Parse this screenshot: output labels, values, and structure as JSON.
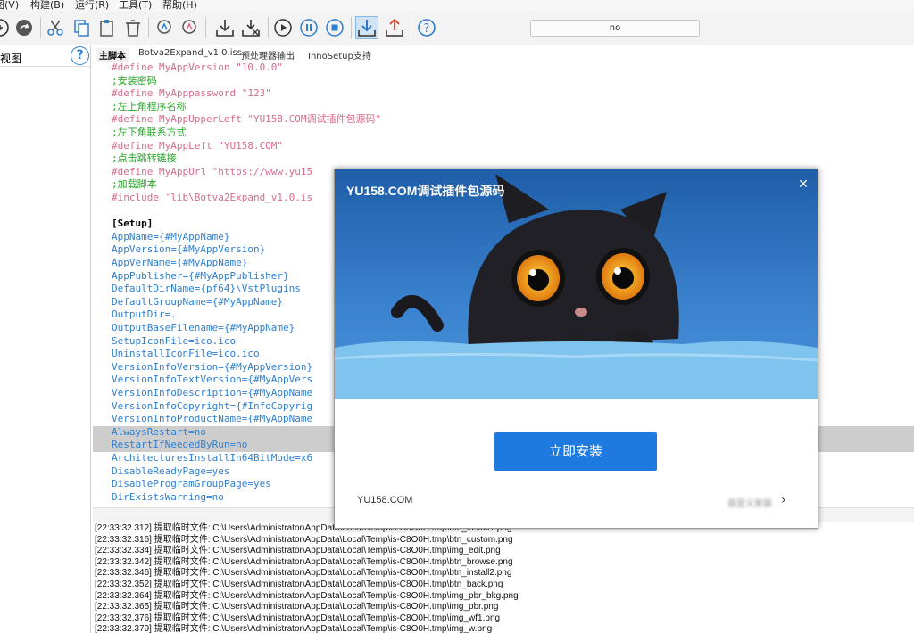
{
  "menu": {
    "view": "图(V)",
    "build": "构建(B)",
    "run": "运行(R)",
    "tools": "工具(T)",
    "help": "帮助(H)"
  },
  "toolbar": {
    "config_value": "no"
  },
  "left_panel": {
    "title": "视图",
    "help_glyph": "?"
  },
  "tabs": [
    "主脚本",
    "Botva2Expand_v1.0.iss",
    "预处理器输出",
    "InnoSetup支持"
  ],
  "editor_lines": [
    {
      "cls": "c-dir",
      "text": "#define MyAppVersion \"10.0.0\""
    },
    {
      "cls": "c-cmt",
      "text": ";安装密码"
    },
    {
      "cls": "c-dir",
      "text": "#define MyApppassword \"123\""
    },
    {
      "cls": "c-cmt",
      "text": ";左上角程序名称"
    },
    {
      "cls": "c-dir",
      "text": "#define MyAppUpperLeft \"YU158.COM调试插件包源码\""
    },
    {
      "cls": "c-cmt",
      "text": ";左下角联系方式"
    },
    {
      "cls": "c-dir",
      "text": "#define MyAppLeft \"YU158.COM\""
    },
    {
      "cls": "c-cmt",
      "text": ";点击跳转链接"
    },
    {
      "cls": "c-dir",
      "text": "#define MyAppUrl \"https://www.yu15"
    },
    {
      "cls": "c-cmt",
      "text": ";加载脚本"
    },
    {
      "cls": "c-dir",
      "text": "#include 'lib\\Botva2Expand_v1.0.is"
    },
    {
      "cls": "",
      "text": ""
    },
    {
      "cls": "c-sec",
      "text": "[Setup]"
    },
    {
      "cls": "c-key",
      "text": "AppName={#MyAppName}"
    },
    {
      "cls": "c-key",
      "text": "AppVersion={#MyAppVersion}"
    },
    {
      "cls": "c-key",
      "text": "AppVerName={#MyAppName}"
    },
    {
      "cls": "c-key",
      "text": "AppPublisher={#MyAppPublisher}"
    },
    {
      "cls": "c-key",
      "text": "DefaultDirName={pf64}\\VstPlugins"
    },
    {
      "cls": "c-key",
      "text": "DefaultGroupName={#MyAppName}"
    },
    {
      "cls": "c-key",
      "text": "OutputDir=."
    },
    {
      "cls": "c-key",
      "text": "OutputBaseFilename={#MyAppName}"
    },
    {
      "cls": "c-key",
      "text": "SetupIconFile=ico.ico"
    },
    {
      "cls": "c-key",
      "text": "UninstallIconFile=ico.ico"
    },
    {
      "cls": "c-key",
      "text": "VersionInfoVersion={#MyAppVersion}"
    },
    {
      "cls": "c-key",
      "text": "VersionInfoTextVersion={#MyAppVers"
    },
    {
      "cls": "c-key",
      "text": "VersionInfoDescription={#MyAppName"
    },
    {
      "cls": "c-key",
      "text": "VersionInfoCopyright={#InfoCopyrig"
    },
    {
      "cls": "c-key",
      "text": "VersionInfoProductName={#MyAppName"
    },
    {
      "cls": "c-key",
      "text": "AlwaysRestart=no",
      "hl": true
    },
    {
      "cls": "c-key",
      "text": "RestartIfNeededByRun=no",
      "hl": true
    },
    {
      "cls": "c-key",
      "text": "ArchitecturesInstallIn64BitMode=x6"
    },
    {
      "cls": "c-key",
      "text": "DisableReadyPage=yes"
    },
    {
      "cls": "c-key",
      "text": "DisableProgramGroupPage=yes"
    },
    {
      "cls": "c-key",
      "text": "DirExistsWarning=no"
    }
  ],
  "log_lines": [
    "[22:33:32.312]   提取临时文件: C:\\Users\\Administrator\\AppData\\Local\\Temp\\is-C8O0H.tmp\\btn_install1.png",
    "[22:33:32.316]   提取临时文件: C:\\Users\\Administrator\\AppData\\Local\\Temp\\is-C8O0H.tmp\\btn_custom.png",
    "[22:33:32.334]   提取临时文件: C:\\Users\\Administrator\\AppData\\Local\\Temp\\is-C8O0H.tmp\\img_edit.png",
    "[22:33:32.342]   提取临时文件: C:\\Users\\Administrator\\AppData\\Local\\Temp\\is-C8O0H.tmp\\btn_browse.png",
    "[22:33:32.346]   提取临时文件: C:\\Users\\Administrator\\AppData\\Local\\Temp\\is-C8O0H.tmp\\btn_install2.png",
    "[22:33:32.352]   提取临时文件: C:\\Users\\Administrator\\AppData\\Local\\Temp\\is-C8O0H.tmp\\btn_back.png",
    "[22:33:32.364]   提取临时文件: C:\\Users\\Administrator\\AppData\\Local\\Temp\\is-C8O0H.tmp\\img_pbr_bkg.png",
    "[22:33:32.365]   提取临时文件: C:\\Users\\Administrator\\AppData\\Local\\Temp\\is-C8O0H.tmp\\img_pbr.png",
    "[22:33:32.376]   提取临时文件: C:\\Users\\Administrator\\AppData\\Local\\Temp\\is-C8O0H.tmp\\img_wf1.png",
    "[22:33:32.379]   提取临时文件: C:\\Users\\Administrator\\AppData\\Local\\Temp\\is-C8O0H.tmp\\img_w.png"
  ],
  "dialog": {
    "title": "YU158.COM调试插件包源码",
    "close_glyph": "✕",
    "install_label": "立即安装",
    "site_label": "YU158.COM",
    "more_label": "自定义安装",
    "more_arrow": "›"
  },
  "colors": {
    "accent": "#1f7ae0",
    "banner_bg": "#2f74c4",
    "directive": "#d86b8a",
    "comment": "#2aa52a",
    "key": "#2e7fd0"
  }
}
